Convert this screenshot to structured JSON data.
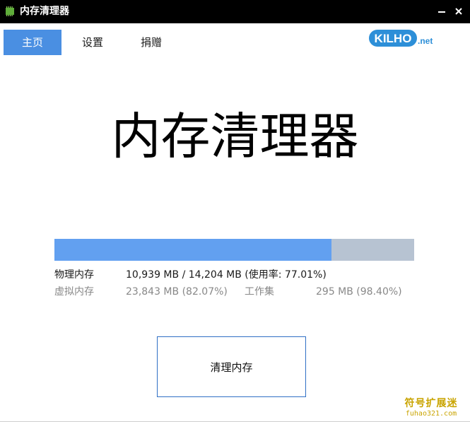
{
  "window": {
    "title": "内存清理器",
    "minimize_icon": "minimize-icon",
    "close_icon": "close-icon"
  },
  "tabs": [
    {
      "label": "主页",
      "active": true
    },
    {
      "label": "设置",
      "active": false
    },
    {
      "label": "捐赠",
      "active": false
    }
  ],
  "logo": {
    "main": "KILHO",
    "suffix": ".net"
  },
  "main": {
    "heading": "内存清理器",
    "progress": {
      "fraction": 0.7701,
      "fill_color": "#62a0f0",
      "track_color": "#b7c3d2"
    },
    "physical": {
      "label": "物理内存",
      "value": "10,939 MB / 14,204 MB (使用率: 77.01%)"
    },
    "virtual": {
      "label": "虚拟内存",
      "value": "23,843 MB (82.07%)"
    },
    "working_set": {
      "label": "工作集",
      "value": "295 MB (98.40%)"
    },
    "clean_button": "清理内存"
  },
  "watermark": {
    "cn": "符号扩展迷",
    "en": "fuhao321.com"
  },
  "colors": {
    "accent": "#4a8fe2",
    "button_border": "#2f6fc5",
    "titlebar": "#000000"
  }
}
